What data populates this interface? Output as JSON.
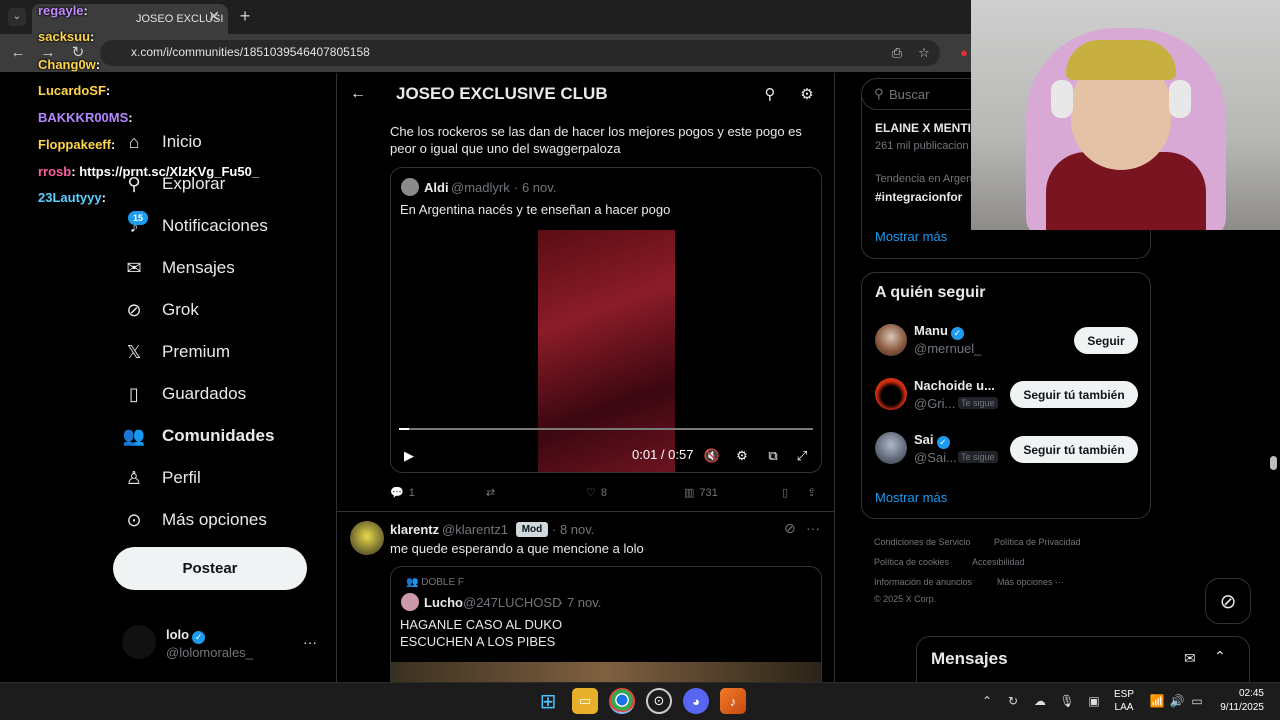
{
  "browser": {
    "tab_title": "JOSEO EXCLUSI",
    "url": "x.com/i/communities/1851039546407805158"
  },
  "nav": {
    "items": [
      {
        "label": "Inicio",
        "icon": "home-icon"
      },
      {
        "label": "Explorar",
        "icon": "search-icon"
      },
      {
        "label": "Notificaciones",
        "icon": "bell-icon",
        "badge": "15"
      },
      {
        "label": "Mensajes",
        "icon": "mail-icon"
      },
      {
        "label": "Grok",
        "icon": "grok-icon"
      },
      {
        "label": "Premium",
        "icon": "x-logo-icon"
      },
      {
        "label": "Guardados",
        "icon": "bookmark-icon"
      },
      {
        "label": "Comunidades",
        "icon": "communities-icon"
      },
      {
        "label": "Perfil",
        "icon": "person-icon"
      },
      {
        "label": "Más opciones",
        "icon": "more-circle-icon"
      }
    ],
    "post_button": "Postear",
    "account": {
      "name": "lolo",
      "handle": "@lolomorales_"
    }
  },
  "community": {
    "title": "JOSEO EXCLUSIVE CLUB"
  },
  "posts": [
    {
      "text": "Che los rockeros se las dan de hacer los mejores pogos y este pogo es peor o igual que uno del swaggerpaloza",
      "quote": {
        "name": "Aldi",
        "handle": "@madlyrk",
        "date": "· 6 nov.",
        "text": "En Argentina nacés y te enseñan a hacer pogo",
        "video_time": "0:01 / 0:57"
      },
      "actions": {
        "replies": "1",
        "reposts": "",
        "likes": "8",
        "views": "731"
      }
    },
    {
      "name": "klarentz",
      "handle": "@klarentz1",
      "badge": "Mod",
      "date": "· 8 nov.",
      "text": "me quede esperando a que mencione a lolo",
      "quote": {
        "community": "DOBLE F",
        "name": "Lucho",
        "handle": "@247LUCHOSD",
        "date": "· 7 nov.",
        "text_line1": "HAGANLE CASO AL DUKO",
        "text_line2": "ESCUCHEN A LOS PIBES"
      }
    }
  ],
  "sidebar": {
    "search_placeholder": "Buscar",
    "trends": [
      {
        "title": "ELAINE X MENTI",
        "meta": "261 mil publicacion"
      },
      {
        "context": "Tendencia en Argen",
        "title": "#integracionfor"
      }
    ],
    "show_more": "Mostrar más",
    "who_to_follow_title": "A quién seguir",
    "who_to_follow": [
      {
        "name": "Manu",
        "handle": "@mernuel_",
        "button": "Seguir",
        "follows_you": ""
      },
      {
        "name": "Nachoide u...",
        "handle": "@Gri...",
        "button": "Seguir tú también",
        "follows_you": "Te sigue"
      },
      {
        "name": "Sai",
        "handle": "@Sai...",
        "button": "Seguir tú también",
        "follows_you": "Te sigue"
      }
    ],
    "show_more_2": "Mostrar más",
    "footer": {
      "l1a": "Condiciones de Servicio",
      "l1b": "Política de Privacidad",
      "l2a": "Política de cookies",
      "l2b": "Accesibilidad",
      "l3a": "Información de anuncios",
      "l3b": "Más opciones ···",
      "copyright": "© 2025 X Corp."
    },
    "messages_title": "Mensajes"
  },
  "chat": [
    {
      "user": "regayle",
      "text": "",
      "color": "#c48cff"
    },
    {
      "user": "sacksuu",
      "text": "",
      "color": "#ffd54a"
    },
    {
      "user": "Chang0w",
      "text": "",
      "color": "#ffd54a"
    },
    {
      "user": "LucardoSF",
      "text": "",
      "color": "#ffd54a"
    },
    {
      "user": "BAKKKR00MS",
      "text": "",
      "color": "#b388ff"
    },
    {
      "user": "Floppakeeff",
      "text": "",
      "color": "#ffd54a"
    },
    {
      "user": "rrosb",
      "text": "https://prnt.sc/XlzKVg_Fu50_",
      "color": "#ff5b9d"
    },
    {
      "user": "23Lautyyy",
      "text": "",
      "color": "#5ad1ff"
    }
  ],
  "taskbar": {
    "lang_line1": "ESP",
    "lang_line2": "LAA",
    "time": "02:45",
    "date": "9/11/2025"
  }
}
